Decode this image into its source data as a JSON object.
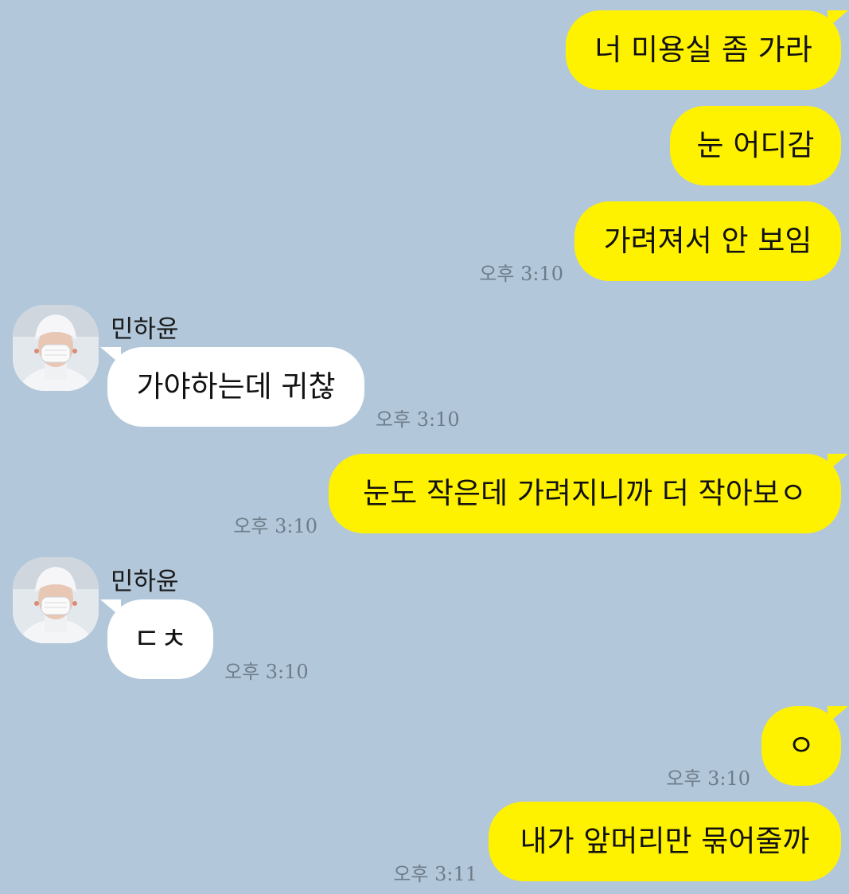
{
  "chat": {
    "messages": [
      {
        "sender": "me",
        "text": "너 미용실 좀 가라",
        "time": ""
      },
      {
        "sender": "me",
        "text": "눈 어디감",
        "time": ""
      },
      {
        "sender": "me",
        "text": "가려져서 안 보임",
        "time": "오후 3:10"
      },
      {
        "sender": "them",
        "name": "민하윤",
        "text": "가야하는데 귀찮",
        "time": "오후 3:10"
      },
      {
        "sender": "me",
        "text": "눈도 작은데 가려지니까 더 작아보ㅇ",
        "time": "오후 3:10"
      },
      {
        "sender": "them",
        "name": "민하윤",
        "text": "ㄷㅊ",
        "time": "오후 3:10"
      },
      {
        "sender": "me",
        "text": "ㅇ",
        "time": "오후 3:10"
      },
      {
        "sender": "me",
        "text": "내가 앞머리만 묶어줄까",
        "time": "오후 3:11"
      }
    ]
  },
  "colors": {
    "background": "#b2c7da",
    "my_bubble": "#fff200",
    "their_bubble": "#ffffff",
    "timestamp": "#6e7c8a"
  },
  "icons": {
    "avatar": "profile-photo-avatar"
  }
}
